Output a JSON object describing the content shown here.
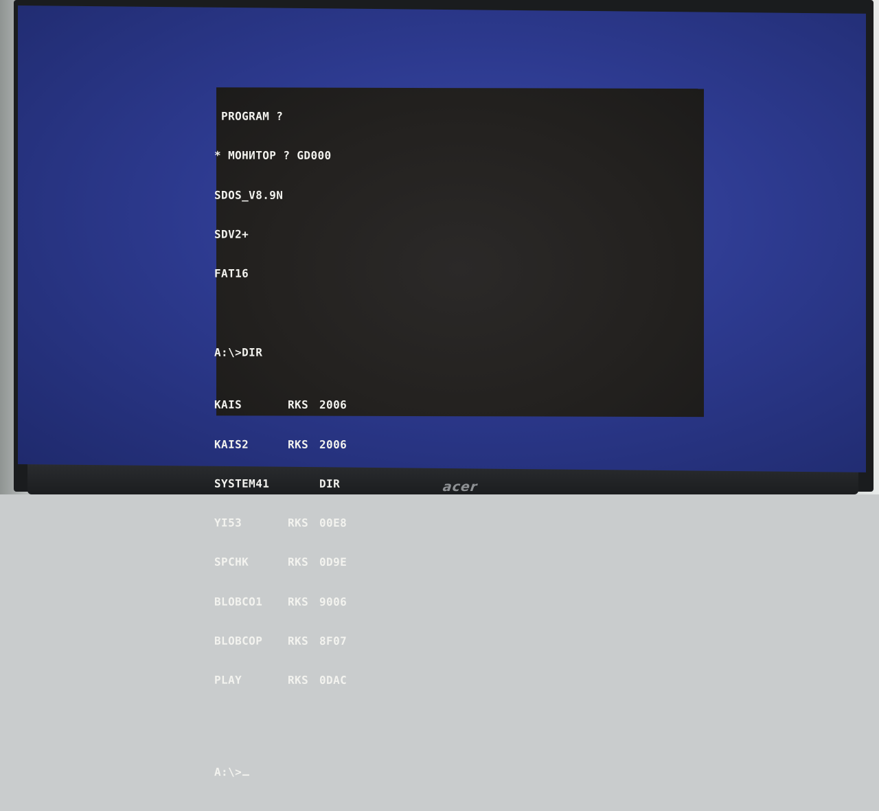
{
  "brand": "acer",
  "terminal": {
    "header_lines": [
      " PROGRAM ?",
      "* МОНИТОР ? GD000",
      "SDOS_V8.9N",
      "SDV2+",
      "FAT16",
      "",
      "A:\\>DIR"
    ],
    "dir_entries": [
      {
        "name": "KAIS",
        "type": "RKS",
        "size": "2006"
      },
      {
        "name": "KAIS2",
        "type": "RKS",
        "size": "2006"
      },
      {
        "name": "SYSTEM41",
        "type": "",
        "size": "DIR"
      },
      {
        "name": "YI53",
        "type": "RKS",
        "size": "00E8"
      },
      {
        "name": "SPCHK",
        "type": "RKS",
        "size": "0D9E"
      },
      {
        "name": "BLOBCO1",
        "type": "RKS",
        "size": "9006"
      },
      {
        "name": "BLOBCOP",
        "type": "RKS",
        "size": "8F07"
      },
      {
        "name": "PLAY",
        "type": "RKS",
        "size": "0DAC"
      }
    ],
    "prompt": "A:\\>"
  }
}
